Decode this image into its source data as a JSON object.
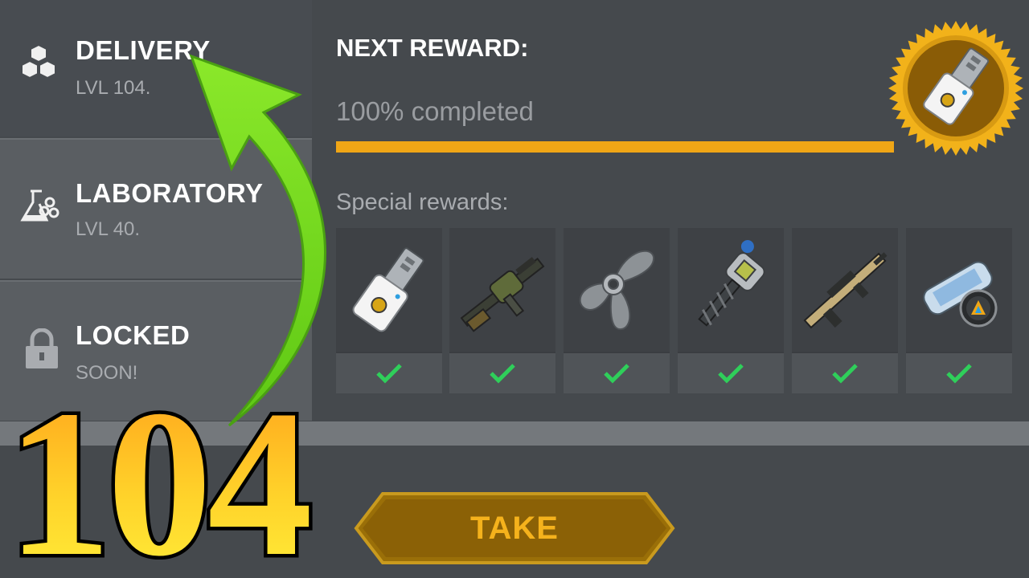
{
  "sidebar": {
    "items": [
      {
        "title": "DELIVERY",
        "subtitle": "LVL 104.",
        "icon": "boxes-icon"
      },
      {
        "title": "LABORATORY",
        "subtitle": "LVL 40.",
        "icon": "flask-icon"
      },
      {
        "title": "LOCKED",
        "subtitle": "SOON!",
        "icon": "lock-icon"
      }
    ]
  },
  "reward": {
    "heading": "NEXT REWARD:",
    "progress_text": "100% completed",
    "progress_value": 1.0,
    "accent_color": "#f0a616",
    "medal_icon": "keycard-icon"
  },
  "special": {
    "label": "Special rewards:",
    "items": [
      {
        "icon": "keycard-icon",
        "claimed": true
      },
      {
        "icon": "grenade-launcher-icon",
        "claimed": true
      },
      {
        "icon": "propeller-icon",
        "claimed": true
      },
      {
        "icon": "drill-icon",
        "claimed": true
      },
      {
        "icon": "rifle-icon",
        "claimed": true
      },
      {
        "icon": "blueprint-scroll-icon",
        "claimed": true
      }
    ]
  },
  "take_button": {
    "label": "TAKE"
  },
  "overlay": {
    "level_number": "104"
  }
}
